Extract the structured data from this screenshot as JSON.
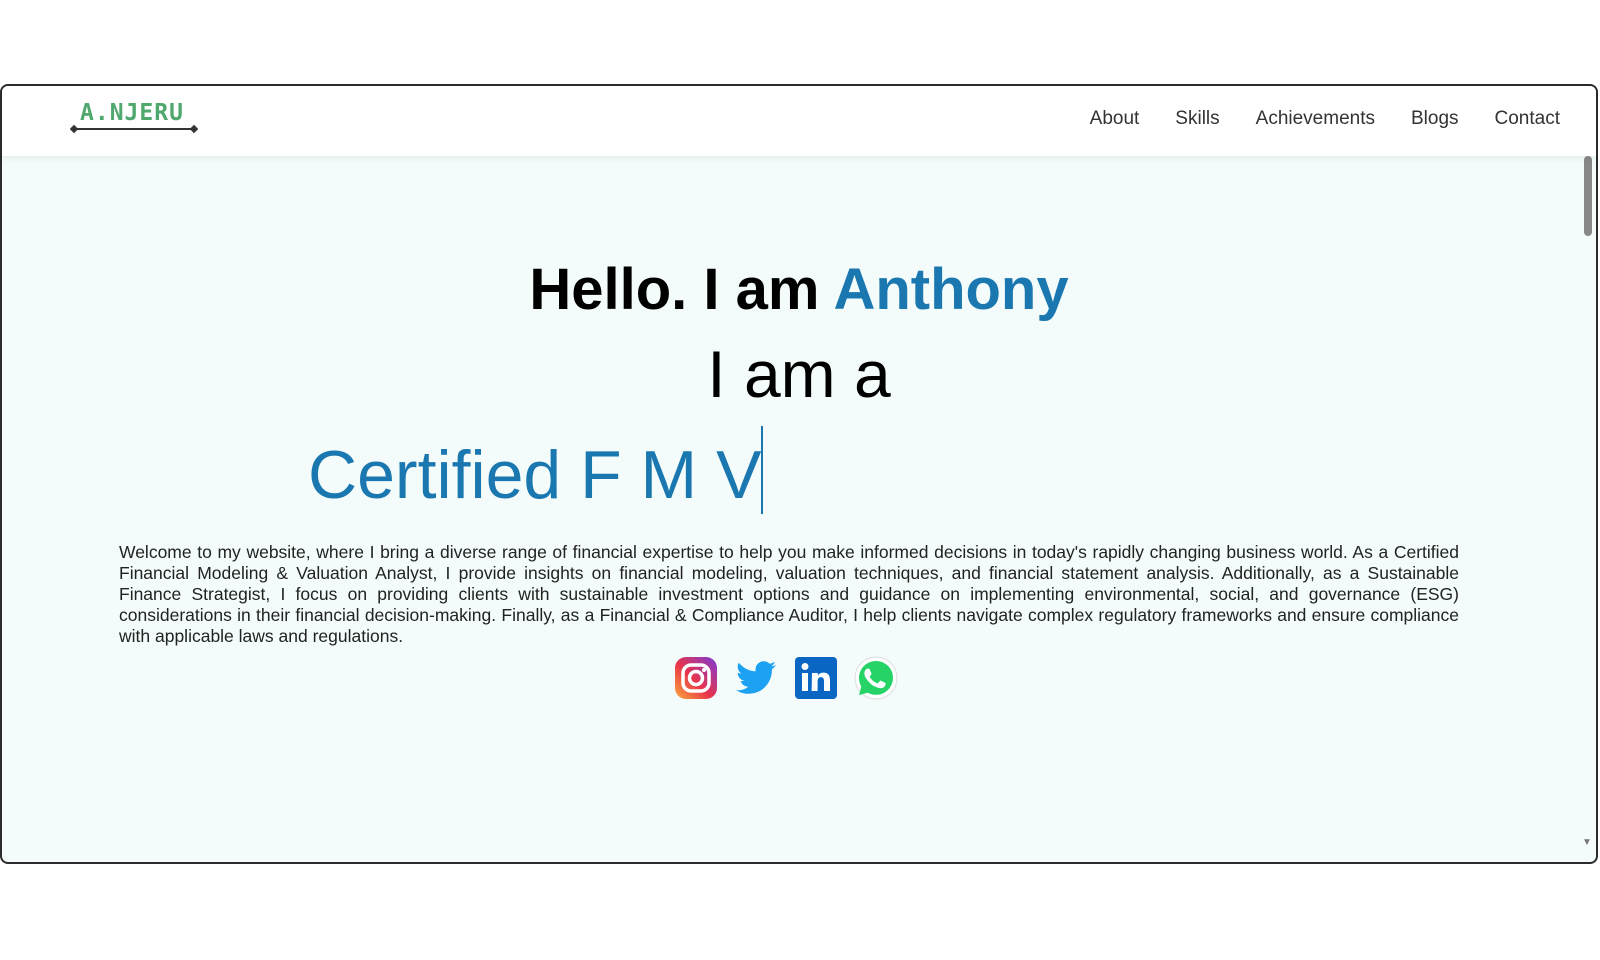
{
  "logo": {
    "text": "A.NJERU"
  },
  "nav": {
    "items": [
      {
        "label": "About"
      },
      {
        "label": "Skills"
      },
      {
        "label": "Achievements"
      },
      {
        "label": "Blogs"
      },
      {
        "label": "Contact"
      }
    ]
  },
  "hero": {
    "greeting": "Hello. I am",
    "name": "Anthony",
    "subtitle": "I am a",
    "typing_text": "Certified F M V",
    "bio": "Welcome to my website, where I bring a diverse range of financial expertise to help you make informed decisions in today's rapidly changing business world. As a Certified Financial Modeling & Valuation Analyst, I provide insights on financial modeling, valuation techniques, and financial statement analysis. Additionally, as a Sustainable Finance Strategist, I focus on providing clients with sustainable investment options and guidance on implementing environmental, social, and governance (ESG) considerations in their financial decision-making. Finally, as a Financial & Compliance Auditor, I help clients navigate complex regulatory frameworks and ensure compliance with applicable laws and regulations."
  },
  "socials": [
    {
      "icon": "instagram-icon"
    },
    {
      "icon": "twitter-icon"
    },
    {
      "icon": "linkedin-icon"
    },
    {
      "icon": "whatsapp-icon"
    }
  ],
  "colors": {
    "accent": "#1a77b0",
    "logo": "#4fa86d",
    "background": "#f3fcfb"
  }
}
